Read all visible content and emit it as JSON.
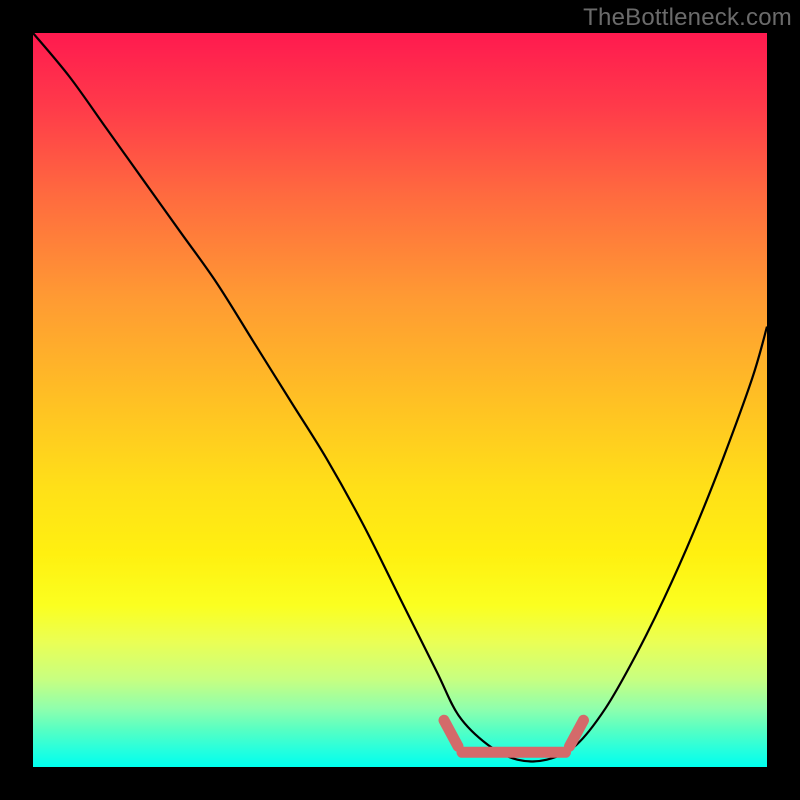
{
  "attribution": "TheBottleneck.com",
  "colors": {
    "curve_stroke": "#000000",
    "bottom_marker": "#d46a6a",
    "gradient_top": "#ff1a4f",
    "gradient_bottom": "#00ffee",
    "frame": "#000000"
  },
  "chart_data": {
    "type": "line",
    "title": "",
    "xlabel": "",
    "ylabel": "",
    "xlim": [
      0,
      100
    ],
    "ylim": [
      0,
      100
    ],
    "series": [
      {
        "name": "bottleneck-curve",
        "x": [
          0,
          5,
          10,
          15,
          20,
          25,
          30,
          35,
          40,
          45,
          50,
          55,
          58,
          62,
          66,
          70,
          74,
          78,
          82,
          86,
          90,
          94,
          98,
          100
        ],
        "y": [
          100,
          94,
          87,
          80,
          73,
          66,
          58,
          50,
          42,
          33,
          23,
          13,
          7,
          3,
          1,
          1,
          3,
          8,
          15,
          23,
          32,
          42,
          53,
          60
        ]
      }
    ],
    "annotations": [
      {
        "name": "optimal-range-marker",
        "x_range": [
          56,
          75
        ],
        "y": 2
      }
    ]
  }
}
